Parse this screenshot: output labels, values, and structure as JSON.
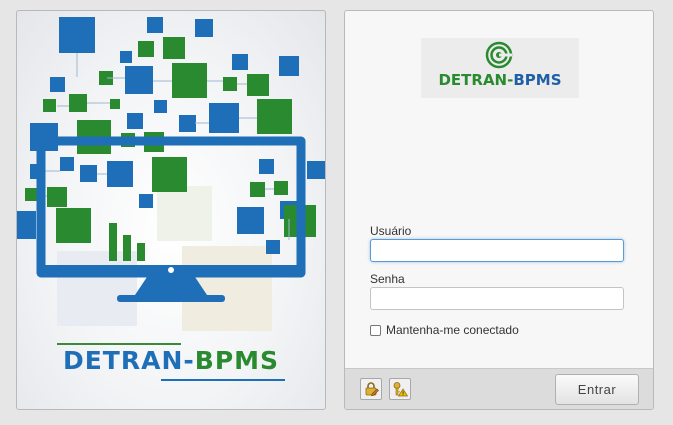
{
  "brand": {
    "part1": "DETRAN",
    "dash": "-",
    "part2": "BPMS"
  },
  "login": {
    "logo": {
      "part1": "DETRAN",
      "dash": "-",
      "part2": "BPMS"
    },
    "username_label": "Usuário",
    "username_value": "",
    "password_label": "Senha",
    "password_value": "",
    "remember_label": "Mantenha-me conectado",
    "remember_checked": false,
    "enter_label": "Entrar"
  },
  "icons": {
    "footer": [
      "lock-edit-icon",
      "key-warning-icon"
    ],
    "logo": "concentric-circles-icon",
    "illustration": "computer-monitor-data-blocks"
  },
  "colors": {
    "brand_blue": "#1e6fb7",
    "brand_green": "#2a8a2f",
    "focus_border": "#5c9ad6"
  }
}
